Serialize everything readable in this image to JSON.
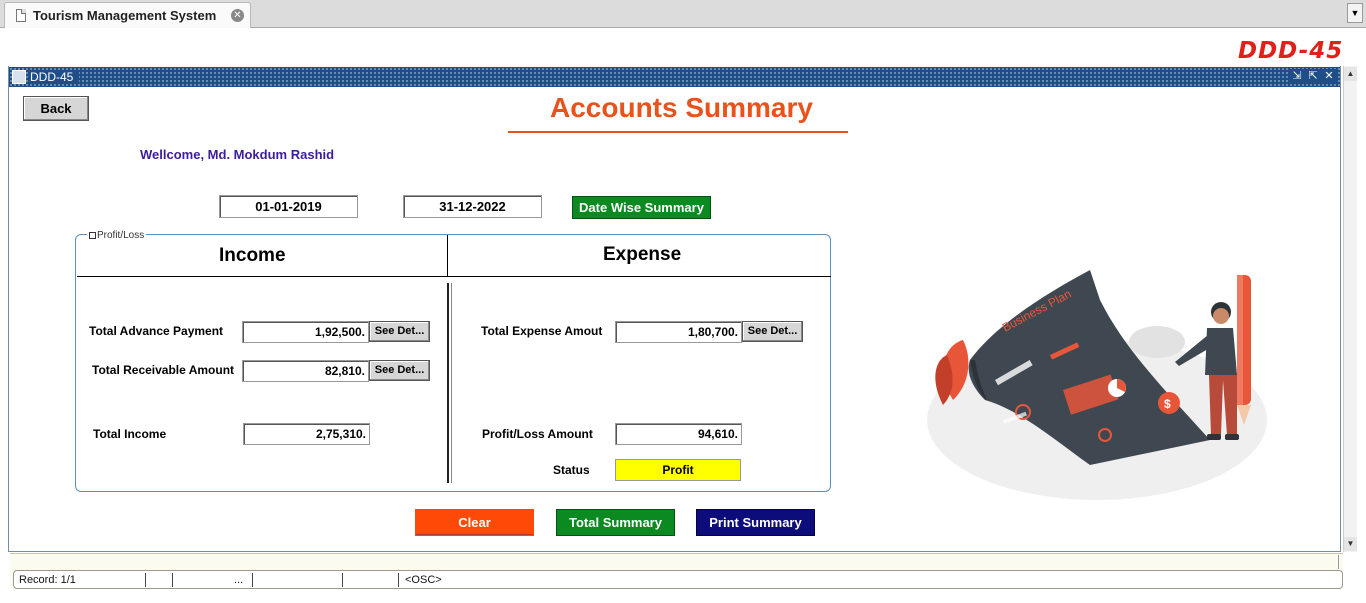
{
  "browser": {
    "tab_title": "Tourism Management System"
  },
  "brand": "DDD-45",
  "window": {
    "title": "DDD-45"
  },
  "header": {
    "back_label": "Back",
    "page_title": "Accounts Summary",
    "welcome_text": "Wellcome, Md. Mokdum Rashid"
  },
  "date_filter": {
    "from": "01-01-2019",
    "to": "31-12-2022",
    "button_label": "Date Wise Summary"
  },
  "panel": {
    "label": "Profit/Loss",
    "income_header": "Income",
    "expense_header": "Expense",
    "income": {
      "advance_payment_label": "Total Advance Payment",
      "advance_payment_value": "1,92,500.",
      "receivable_label": "Total Receivable Amount",
      "receivable_value": "82,810.",
      "total_income_label": "Total Income",
      "total_income_value": "2,75,310."
    },
    "expense": {
      "total_expense_label": "Total Expense Amout",
      "total_expense_value": "1,80,700.",
      "profit_loss_label": "Profit/Loss Amount",
      "profit_loss_value": "94,610.",
      "status_label": "Status",
      "status_value": "Profit"
    },
    "see_details_label": "See Det..."
  },
  "actions": {
    "clear_label": "Clear",
    "total_summary_label": "Total Summary",
    "print_summary_label": "Print Summary"
  },
  "illustration": {
    "banner_text": "Business Plan"
  },
  "status_bar": {
    "record": "Record: 1/1",
    "ellipsis": "...",
    "mode": "<OSC>"
  },
  "colors": {
    "title_orange": "#e8521c",
    "green_button": "#0a8a20",
    "navy_button": "#0c0c7a",
    "clear_button": "#ff4a07",
    "status_yellow": "#ffff00",
    "welcome_purple": "#3b1d9e",
    "brand_red": "#e0201b"
  }
}
